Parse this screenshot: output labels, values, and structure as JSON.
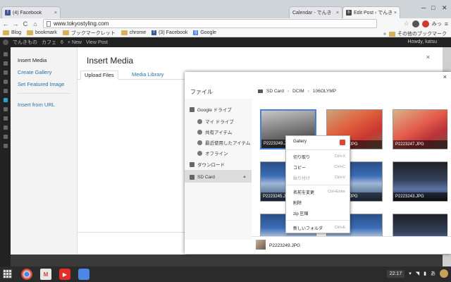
{
  "browser": {
    "tabs": [
      {
        "title": "(4) Facebook",
        "icon": "facebook-icon",
        "close": "×"
      },
      {
        "title": "Calendar - でんき",
        "icon": "calendar-icon",
        "close": "×"
      },
      {
        "title": "Edit Post ‹ でんき",
        "icon": "wordpress-icon",
        "close": "×"
      }
    ],
    "window_controls": {
      "minimize": "─",
      "maximize": "□",
      "close": "✕"
    },
    "nav": {
      "back": "←",
      "forward": "→",
      "reload": "C",
      "home": "⌂"
    },
    "url": "www.tokyostyling.com",
    "ext_icons": [
      "star-icon",
      "extension-icon",
      "chrome-icon",
      "translate-icon",
      "menu-icon"
    ],
    "ext_text": "みっ"
  },
  "bookmarks": {
    "items": [
      {
        "label": "Blog",
        "type": "folder"
      },
      {
        "label": "bookmark",
        "type": "folder"
      },
      {
        "label": "ブックマークレット",
        "type": "folder"
      },
      {
        "label": "chrome",
        "type": "folder"
      },
      {
        "label": "(3) Facebook",
        "type": "facebook"
      },
      {
        "label": "Google",
        "type": "google"
      }
    ],
    "more_label": "»",
    "other_label": "その他のブックマーク"
  },
  "wp_admin_bar": {
    "site": "でんきもの",
    "customize": "カフェ",
    "comments_count": "6",
    "new": "+ New",
    "view_post": "View Post",
    "howdy": "Howdy, katsu"
  },
  "modal": {
    "menu": {
      "insert_media": "Insert Media",
      "create_gallery": "Create Gallery",
      "set_featured_image": "Set Featured Image",
      "insert_from_url": "Insert from URL"
    },
    "title": "Insert Media",
    "close": "×",
    "tabs": [
      "Upload Files",
      "Media Library"
    ]
  },
  "files": {
    "sidebar_title": "ファイル",
    "close": "×",
    "sidebar": {
      "google_drive": "Google ドライブ",
      "my_drive": "マイ ドライブ",
      "shared": "共有アイテム",
      "recent": "最近使用したアイテム",
      "offline": "オフライン",
      "downloads": "ダウンロード",
      "sd_card": "SD Card",
      "eject": "▲"
    },
    "breadcrumb": [
      "SD Card",
      "DCIM",
      "106OLYMP"
    ],
    "breadcrumb_sep": "›",
    "thumbnails": [
      {
        "name": "P2223249.JPG",
        "style": "laptop",
        "selected": true
      },
      {
        "name": "P2223248.JPG",
        "style": "red2",
        "selected": false
      },
      {
        "name": "P2223247.JPG",
        "style": "red",
        "selected": false
      },
      {
        "name": "P2223245.JPG",
        "style": "screen",
        "selected": false
      },
      {
        "name": "P2223244.JPG",
        "style": "screen",
        "selected": false
      },
      {
        "name": "P2223243.JPG",
        "style": "dark",
        "selected": false
      },
      {
        "name": "P2223242.JPG",
        "style": "screen",
        "selected": false
      },
      {
        "name": "P2223241.JPG",
        "style": "screen",
        "selected": false
      },
      {
        "name": "P2223240.JPG",
        "style": "dark",
        "selected": false
      }
    ],
    "selected_file": "P2223249.JPG"
  },
  "context_menu": {
    "gallery": "Gallery",
    "cut": "切り取り",
    "cut_sc": "Ctrl+X",
    "copy": "コピー",
    "copy_sc": "Ctrl+C",
    "paste": "貼り付け",
    "paste_sc": "Ctrl+V",
    "rename": "名前を変更",
    "rename_sc": "Ctrl+Enter",
    "delete": "削除",
    "zip": "zip 圧縮",
    "new_folder": "新しいフォルダ",
    "new_folder_sc": "Ctrl+E"
  },
  "shelf": {
    "apps": [
      "chrome-icon",
      "gmail-icon",
      "youtube-icon",
      "files-icon"
    ],
    "clock": "22:17",
    "ime": "あ"
  },
  "colors": {
    "accent": "#4a7fd6",
    "wp_link": "#2a72a8",
    "admin_bar": "#222222"
  }
}
